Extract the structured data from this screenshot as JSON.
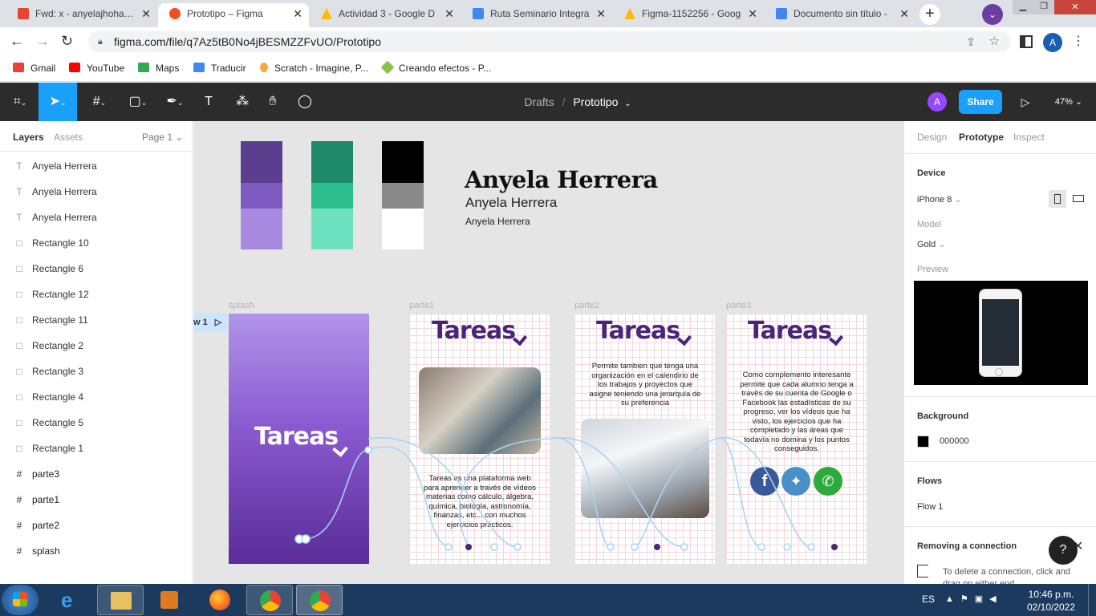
{
  "browser": {
    "tabs": [
      {
        "title": "Fwd: x - anyelajhohana",
        "color": "#ea4335"
      },
      {
        "title": "Prototipo – Figma",
        "color": "#f24e1e"
      },
      {
        "title": "Actividad 3 - Google D",
        "color": "#1a73e8"
      },
      {
        "title": "Ruta Seminario Integra",
        "color": "#4285f4"
      },
      {
        "title": "Figma-1152256 - Goog",
        "color": "#1a73e8"
      },
      {
        "title": "Documento sin título -",
        "color": "#4285f4"
      }
    ],
    "url": "figma.com/file/q7Az5tB0No4jBESMZZFvUO/Prototipo",
    "profile_initial": "A",
    "bookmarks": [
      {
        "label": "Gmail",
        "color": "#ea4335"
      },
      {
        "label": "YouTube",
        "color": "#ff0000"
      },
      {
        "label": "Maps",
        "color": "#34a853"
      },
      {
        "label": "Traducir",
        "color": "#4285f4"
      },
      {
        "label": "Scratch - Imagine, P...",
        "color": "#f4a742"
      },
      {
        "label": "Creando efectos - P...",
        "color": "#8bc34a"
      }
    ]
  },
  "figma": {
    "breadcrumb_parent": "Drafts",
    "breadcrumb_separator": "/",
    "file_name": "Prototipo",
    "user_initial": "A",
    "share_label": "Share",
    "zoom": "47%",
    "left_tabs": {
      "layers": "Layers",
      "assets": "Assets",
      "page": "Page 1"
    },
    "layers": [
      {
        "name": "Anyela Herrera",
        "type": "text"
      },
      {
        "name": "Anyela Herrera",
        "type": "text"
      },
      {
        "name": "Anyela Herrera",
        "type": "text"
      },
      {
        "name": "Rectangle 10",
        "type": "rect"
      },
      {
        "name": "Rectangle 6",
        "type": "rect"
      },
      {
        "name": "Rectangle 12",
        "type": "rect"
      },
      {
        "name": "Rectangle 11",
        "type": "rect"
      },
      {
        "name": "Rectangle 2",
        "type": "rect"
      },
      {
        "name": "Rectangle 3",
        "type": "rect"
      },
      {
        "name": "Rectangle 4",
        "type": "rect"
      },
      {
        "name": "Rectangle 5",
        "type": "rect"
      },
      {
        "name": "Rectangle 1",
        "type": "rect"
      },
      {
        "name": "parte3",
        "type": "frame"
      },
      {
        "name": "parte1",
        "type": "frame"
      },
      {
        "name": "parte2",
        "type": "frame"
      },
      {
        "name": "splash",
        "type": "frame"
      }
    ],
    "right_tabs": {
      "design": "Design",
      "prototype": "Prototype",
      "inspect": "Inspect"
    },
    "device_section": "Device",
    "device": "iPhone 8",
    "model_label": "Model",
    "model": "Gold",
    "preview_label": "Preview",
    "background_section": "Background",
    "background_value": "000000",
    "background_color": "#000000",
    "flows_section": "Flows",
    "flow": "Flow 1",
    "tip_title": "Removing a connection",
    "tip_text": "To delete a connection, click and drag on either end",
    "help": "?"
  },
  "canvas": {
    "swatches": [
      [
        "#5b3f8e",
        "#7d5bc0",
        "#a88ae0"
      ],
      [
        "#1f8a68",
        "#2ebf8e",
        "#6ee2c0"
      ],
      [
        "#000000",
        "#8a8a8a",
        "#ffffff"
      ]
    ],
    "type_samples": [
      "Anyela Herrera",
      "Anyela Herrera",
      "Anyela Herrera"
    ],
    "flow_tag": "w 1",
    "frames": {
      "splash": {
        "label": "splash",
        "logo": "Tareas"
      },
      "parte1": {
        "label": "parte1",
        "logo": "Tareas",
        "text": "Tareas es una plataforma web para aprender a través de vídeos materias como cálculo, álgebra, química, biología, astronomía, finanzas, etc... con muchos ejercicios prácticos."
      },
      "parte2": {
        "label": "parte2",
        "logo": "Tareas",
        "text": "Permite tambien que tenga una organización en el calendirio de los trabajos y proyectos que asigne teniendo una jerarquía de su preferencia"
      },
      "parte3": {
        "label": "parte3",
        "logo": "Tareas",
        "text": "Como complemento interesante permite que cada alumno tenga a través de su cuenta de Google o Facebook las estadísticas de su progreso, ver los vídeos que ha visto, los ejercicios que ha completado y las áreas que todavía no domina y los puntos conseguidos."
      }
    }
  },
  "taskbar": {
    "lang": "ES",
    "time": "10:46 p.m.",
    "date": "02/10/2022"
  }
}
